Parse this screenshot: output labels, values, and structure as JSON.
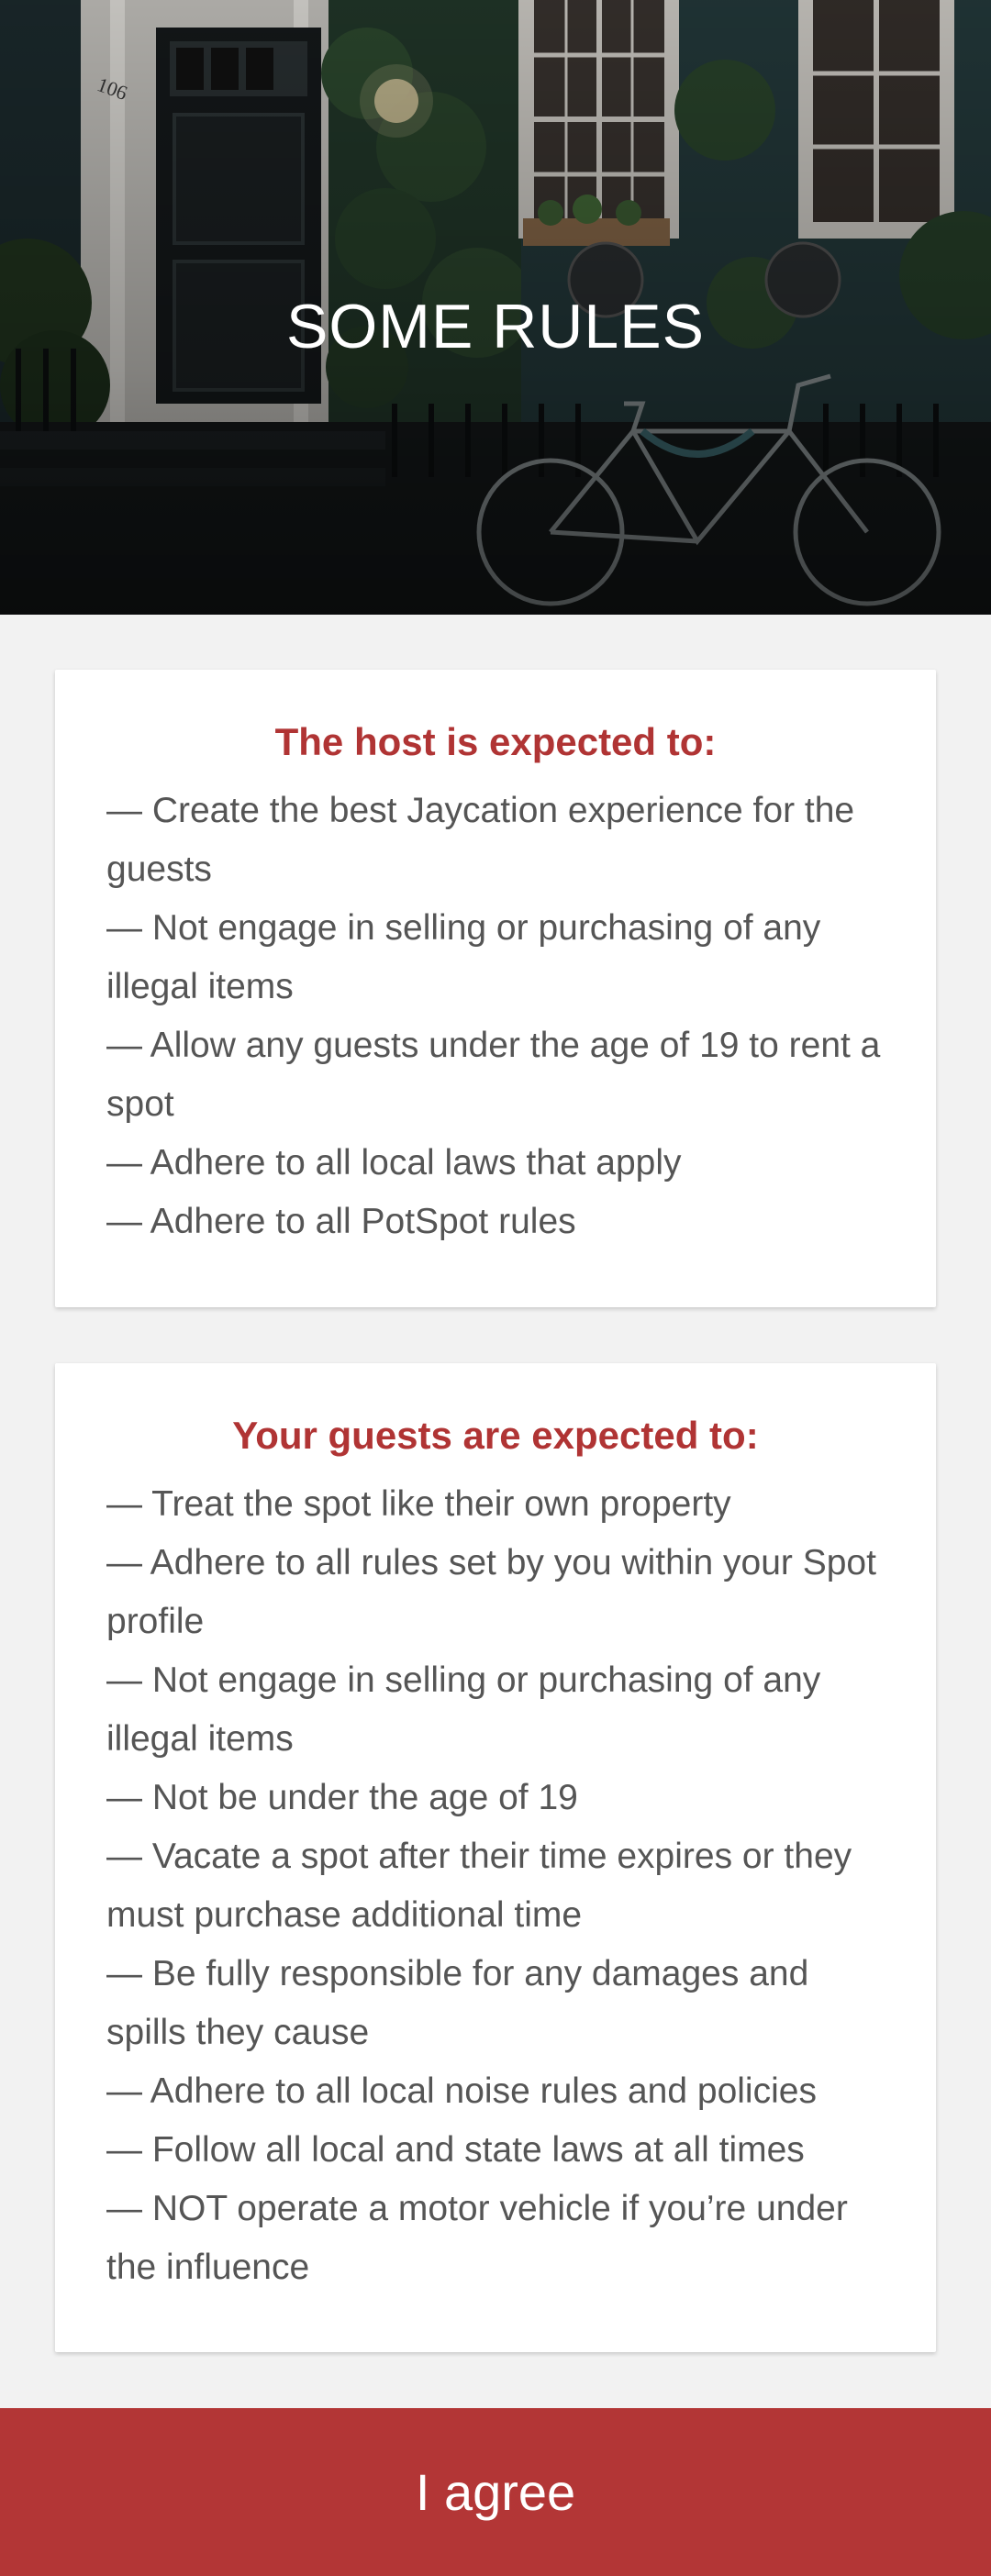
{
  "hero": {
    "title": "SOME RULES",
    "door_number": "106"
  },
  "host_card": {
    "title": "The host is expected to:",
    "rules": [
      "— Create the best Jaycation experience for the guests",
      "— Not engage in selling or purchasing of any illegal items",
      "— Allow any guests under the age of 19 to rent a spot",
      "— Adhere to all local laws that apply",
      "— Adhere to all PotSpot rules"
    ]
  },
  "guest_card": {
    "title": "Your guests are expected to:",
    "rules": [
      "— Treat the spot like their own property",
      "— Adhere to all rules set by you within your Spot profile",
      "— Not engage in  selling or purchasing of any illegal items",
      "— Not be under the age of 19",
      "— Vacate a spot after their time expires or they must purchase additional time",
      "— Be fully responsible for any damages and spills they cause",
      "— Adhere to all local noise rules and policies",
      "— Follow all local and state laws at all times",
      "— NOT operate a motor vehicle if you’re under the influence"
    ]
  },
  "footer": {
    "agree_label": "I agree"
  },
  "colors": {
    "accent": "#b33636",
    "heading": "#b03434",
    "body_text": "#555555",
    "background": "#f2f2f2"
  }
}
